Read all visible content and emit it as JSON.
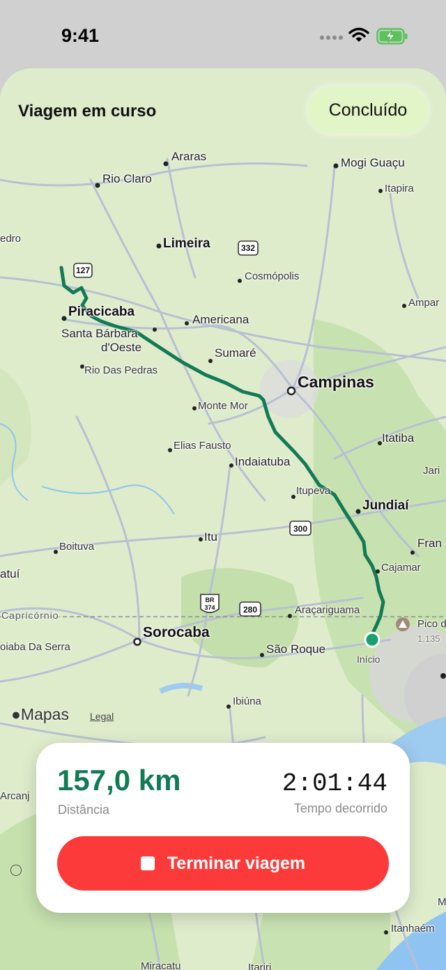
{
  "status_bar": {
    "time": "9:41"
  },
  "header": {
    "title": "Viagem em curso",
    "done_label": "Concluído"
  },
  "map": {
    "places": {
      "araras": "Araras",
      "mogi_guacu": "Mogi Guaçu",
      "rio_claro": "Rio Claro",
      "itapira": "Itapira",
      "pedro": "edro",
      "limeira": "Limeira",
      "cosmopolis": "Cosmópolis",
      "amparo": "Ampar",
      "piracicaba": "Piracicaba",
      "americana": "Americana",
      "santa_barbara_1": "Santa Bárbara",
      "santa_barbara_2": "d'Oeste",
      "sumare": "Sumaré",
      "rio_das_pedras": "Rio Das Pedras",
      "campinas": "Campinas",
      "monte_mor": "Monte Mor",
      "itatiba": "Itatiba",
      "elias_fausto": "Elias Fausto",
      "jari": "Jari",
      "indaiatuba": "Indaiatuba",
      "itupeva": "Itupeva",
      "jundiai": "Jundiaí",
      "itu": "Itu",
      "boituva": "Boituva",
      "fran": "Fran",
      "atui": "atuí",
      "cajamar": "Cajamar",
      "capricornio": "Capricórnio",
      "aracariguama": "Araçariguama",
      "pico": "Pico d",
      "pico_alt": "1.135",
      "sorocaba": "Sorocaba",
      "piaba_da_serra": "oiaba Da Serra",
      "sao_roque": "São Roque",
      "inicio": "Início",
      "ibiuna": "Ibiúna",
      "arcanj": "Arcanj",
      "itanhaem": "Itanhaém",
      "miracatu": "Miracatu",
      "itariri": "Itariri",
      "m": "M"
    },
    "shields": {
      "r127": "127",
      "r332": "332",
      "r300": "300",
      "r280": "280",
      "br_top": "BR",
      "br_num": "374"
    },
    "route_color": "#127a55",
    "attribution": {
      "logo": "Mapas",
      "legal": "Legal"
    }
  },
  "trip": {
    "distance_value": "157,0 km",
    "distance_label": "Distância",
    "time_value": "2:01:44",
    "time_label": "Tempo decorrido",
    "end_label": "Terminar viagem"
  }
}
